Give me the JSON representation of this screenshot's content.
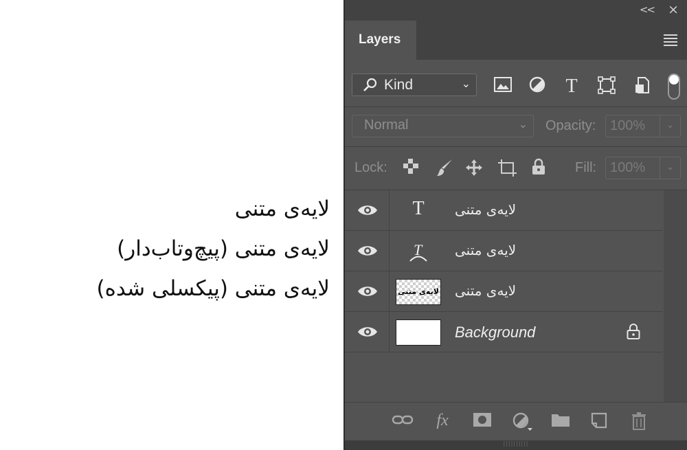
{
  "annotations": [
    "لایه‌ی متنی",
    "لایه‌ی متنی (پیچ‌وتاب‌دار)",
    "لایه‌ی متنی (پیکسلی شده)"
  ],
  "panel": {
    "tab_label": "Layers",
    "collapse_glyph": "<<",
    "close_glyph": "×",
    "filter": {
      "kind_label": "Kind",
      "kind_icon": "search-icon",
      "chevron": "⌄"
    },
    "blend_mode": "Normal",
    "opacity_label": "Opacity:",
    "opacity_value": "100%",
    "lock_label": "Lock:",
    "fill_label": "Fill:",
    "fill_value": "100%",
    "layers": [
      {
        "name": "لایه‌ی متنی",
        "type": "text",
        "thumb_glyph": "T"
      },
      {
        "name": "لایه‌ی متنی",
        "type": "warped-text",
        "thumb_glyph": "T"
      },
      {
        "name": "لایه‌ی متنی",
        "type": "pixel",
        "thumb_text": "لایه‌ی متنی"
      },
      {
        "name": "Background",
        "type": "background",
        "locked": true
      }
    ],
    "bottom_fx_label": "fx"
  },
  "colors": {
    "panel_bg": "#535353",
    "header_bg": "#424242",
    "text": "#eeeeee"
  }
}
